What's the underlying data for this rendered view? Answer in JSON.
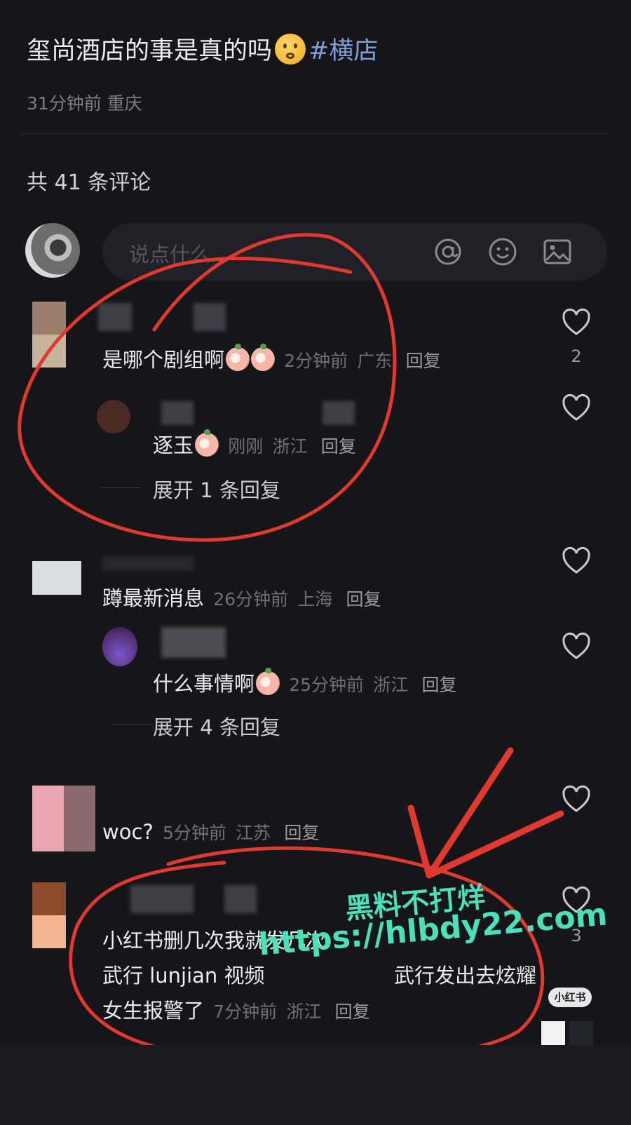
{
  "post": {
    "title": "玺尚酒店的事是真的吗",
    "title_emoji": "worried-face",
    "hashtag": "#横店",
    "time": "31分钟前",
    "location": "重庆"
  },
  "comments_header": {
    "label": "共 41 条评论"
  },
  "input": {
    "placeholder": "说点什么..."
  },
  "toolbar": {
    "icons": [
      "at-icon",
      "emoji-icon",
      "image-icon"
    ]
  },
  "comments": [
    {
      "text": "是哪个剧组啊",
      "emoji": "peach-emoji",
      "time": "2分钟前",
      "location": "广东",
      "reply": "回复",
      "likes": "2"
    },
    {
      "text": "逐玉",
      "emoji": "peach-emoji",
      "time": "刚刚",
      "location": "浙江",
      "reply": "回复"
    },
    {
      "expand": "展开 1 条回复"
    },
    {
      "text": "蹲最新消息",
      "time": "26分钟前",
      "location": "上海",
      "reply": "回复"
    },
    {
      "text": "什么事情啊",
      "emoji": "peach-emoji",
      "time": "25分钟前",
      "location": "浙江",
      "reply": "回复"
    },
    {
      "expand": "展开 4 条回复"
    },
    {
      "text": "woc?",
      "time": "5分钟前",
      "location": "江苏",
      "reply": "回复"
    },
    {
      "line1": "小红书删几次我就发几次",
      "line2": "武行 lunjian  视频",
      "line2b": "武行发出去炫耀",
      "line3": "女生报警了",
      "time": "7分钟前",
      "location": "浙江",
      "reply": "回复",
      "likes": "3"
    }
  ],
  "watermark": {
    "line1": "黑料不打烊",
    "line2": "https://hlbdy22.com"
  },
  "badge": {
    "label": "小红书"
  },
  "colors": {
    "background": "#15151a",
    "accent_watermark": "#4be0ba",
    "annotation_red": "#e0392f"
  }
}
